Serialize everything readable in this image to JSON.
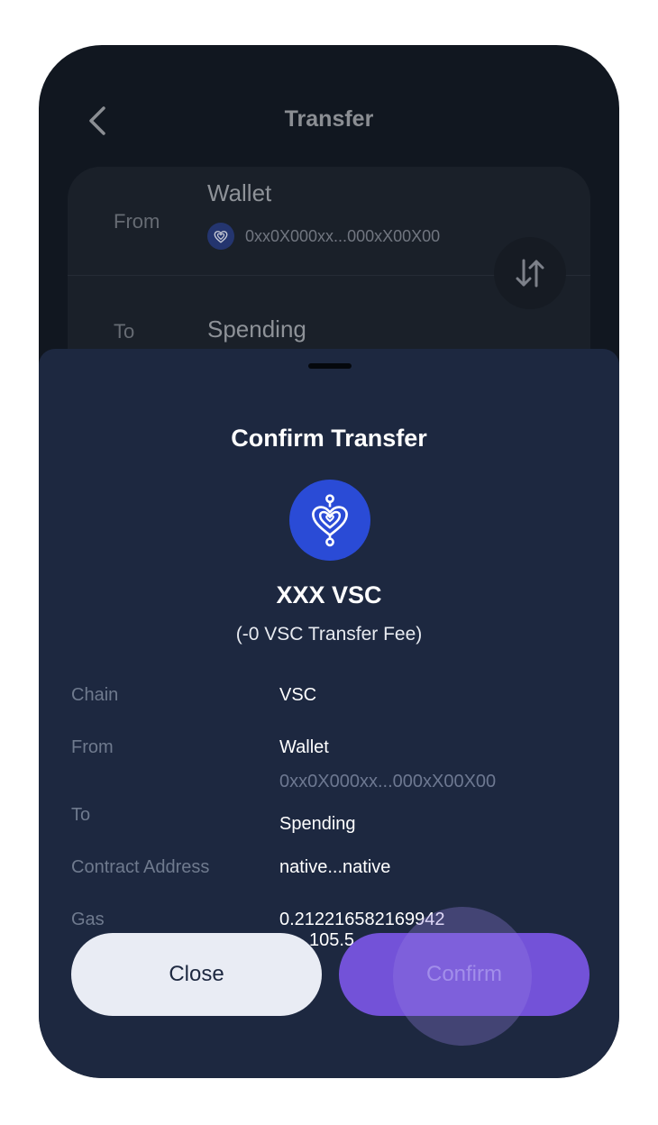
{
  "header": {
    "title": "Transfer"
  },
  "transfer_card": {
    "from_label": "From",
    "from_value": "Wallet",
    "from_address": "0xx0X000xx...000xX00X00",
    "to_label": "To",
    "to_value": "Spending"
  },
  "sheet": {
    "title": "Confirm Transfer",
    "amount": "XXX VSC",
    "fee": "(-0 VSC Transfer Fee)",
    "details": {
      "chain_label": "Chain",
      "chain_value": "VSC",
      "from_label": "From",
      "from_value": "Wallet",
      "from_address": "0xx0X000xx...000xX00X00",
      "to_label": "To",
      "to_value": "Spending",
      "contract_label": "Contract Address",
      "contract_value": "native...native",
      "gas_label": "Gas",
      "gas_value": "0.212216582169942",
      "gas_secondary": "105.5"
    },
    "close_label": "Close",
    "confirm_label": "Confirm"
  },
  "colors": {
    "screen_bg": "#111720",
    "sheet_bg": "#1d2840",
    "accent": "#7352d8",
    "token_blue": "#2a4bd6"
  },
  "icons": {
    "back": "chevron-left-icon",
    "swap": "swap-vertical-icon",
    "token": "vsc-logo-icon"
  }
}
